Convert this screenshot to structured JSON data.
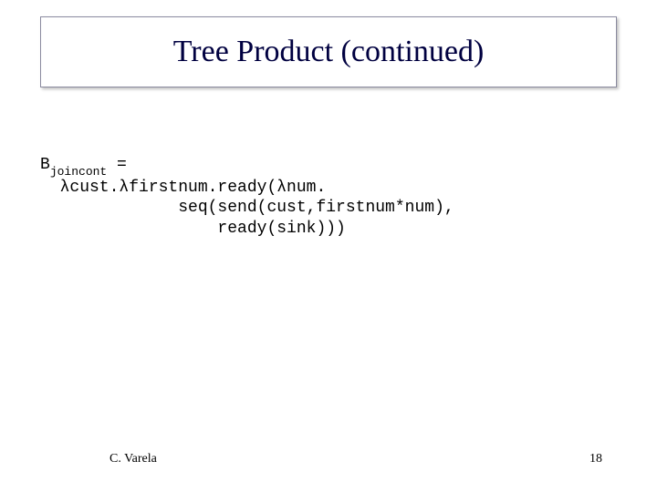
{
  "title": "Tree Product (continued)",
  "code": {
    "behavior_prefix": "B",
    "behavior_sub": "joincont",
    "eq": " =",
    "line2": "  λcust.λfirstnum.ready(λnum.",
    "line3": "              seq(send(cust,firstnum*num),",
    "line4": "                  ready(sink)))"
  },
  "footer": {
    "author": "C. Varela",
    "page": "18"
  }
}
